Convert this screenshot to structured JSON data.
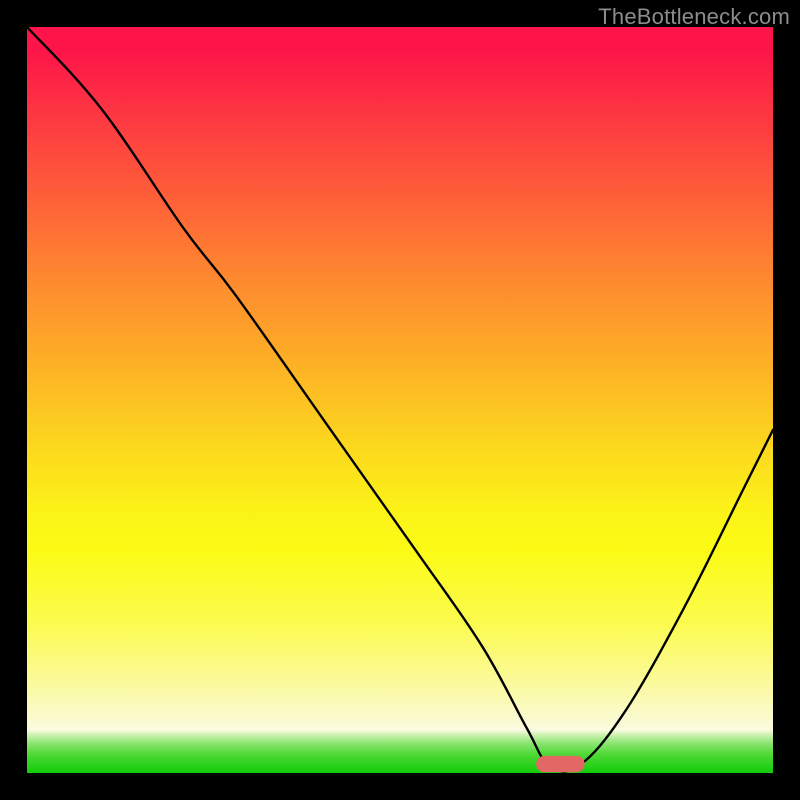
{
  "watermark": "TheBottleneck.com",
  "chart_data": {
    "type": "line",
    "title": "",
    "xlabel": "",
    "ylabel": "",
    "xlim": [
      0,
      100
    ],
    "ylim": [
      0,
      100
    ],
    "background_gradient": {
      "stops": [
        {
          "offset": 0,
          "color": "#fd1448"
        },
        {
          "offset": 0.33,
          "color": "#fe8630"
        },
        {
          "offset": 0.65,
          "color": "#fbf318"
        },
        {
          "offset": 0.93,
          "color": "#fafad2"
        },
        {
          "offset": 1.0,
          "color": "#10cb09"
        }
      ]
    },
    "series": [
      {
        "name": "bottleneck-curve",
        "x": [
          0,
          10,
          21,
          28,
          40,
          52,
          61,
          67,
          70,
          74,
          80,
          88,
          96,
          100
        ],
        "y": [
          100,
          89,
          73,
          64,
          47,
          30,
          17,
          6,
          1,
          1,
          8,
          22,
          38,
          46
        ]
      }
    ],
    "marker": {
      "name": "optimal-region",
      "x_center": 71.5,
      "y_center": 1.2,
      "width": 6.5,
      "height": 2.2,
      "color": "#e36764"
    }
  }
}
